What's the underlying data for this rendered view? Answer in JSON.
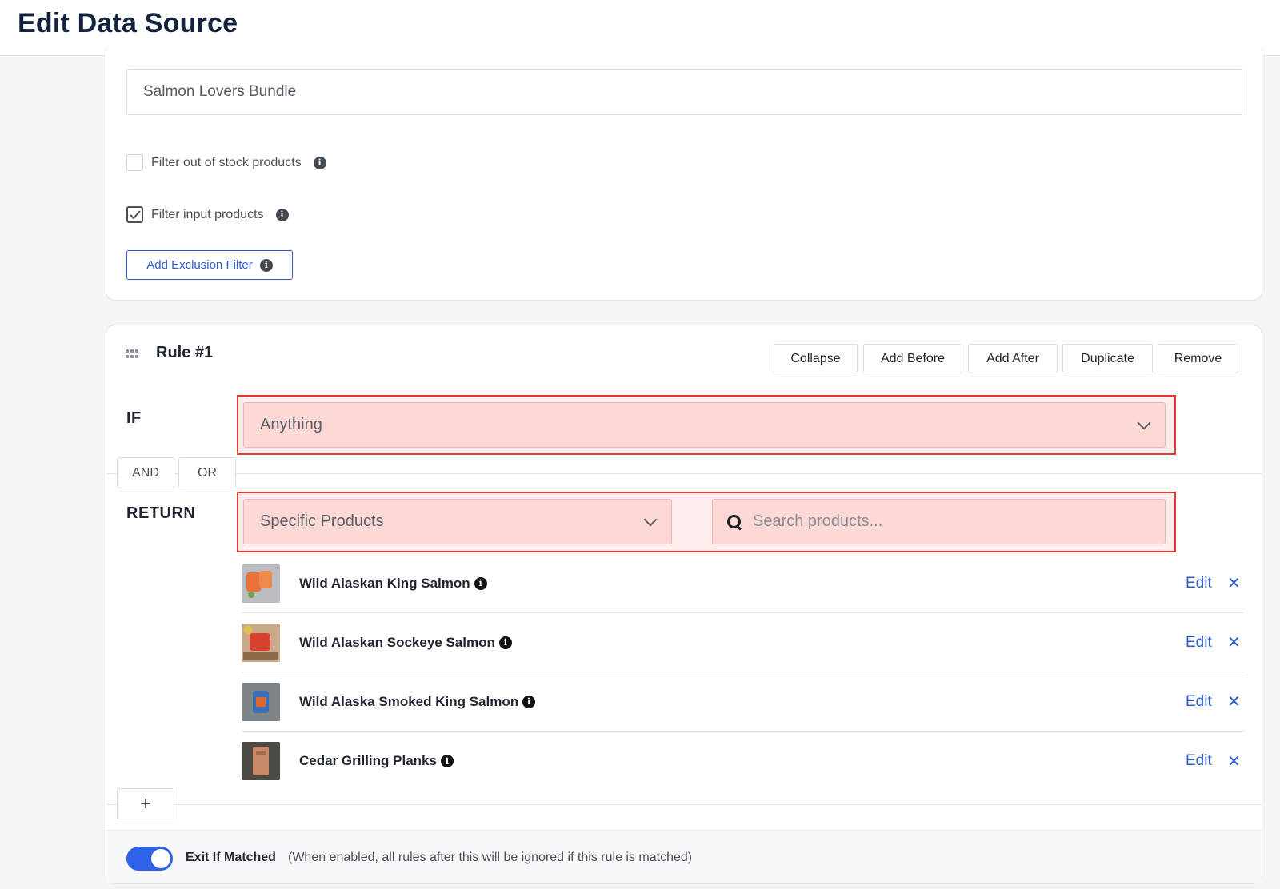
{
  "header": {
    "title": "Edit Data Source"
  },
  "source": {
    "name_value": "Salmon Lovers Bundle",
    "filter_out_of_stock": {
      "label": "Filter out of stock products",
      "checked": false
    },
    "filter_input": {
      "label": "Filter input products",
      "checked": true
    },
    "add_exclusion_label": "Add Exclusion Filter"
  },
  "rule": {
    "title": "Rule #1",
    "actions": [
      "Collapse",
      "Add Before",
      "Add After",
      "Duplicate",
      "Remove"
    ],
    "if_label": "IF",
    "if_value": "Anything",
    "and_label": "AND",
    "or_label": "OR",
    "return_label": "RETURN",
    "return_value": "Specific Products",
    "search_placeholder": "Search products...",
    "edit_label": "Edit",
    "remove_glyph": "✕",
    "products": [
      {
        "name": "Wild Alaskan King Salmon"
      },
      {
        "name": "Wild Alaskan Sockeye Salmon"
      },
      {
        "name": "Wild Alaska Smoked King Salmon"
      },
      {
        "name": "Cedar Grilling Planks"
      }
    ],
    "add_rule_glyph": "+"
  },
  "footer": {
    "exit_label": "Exit If Matched",
    "exit_note": "(When enabled, all rules after this will be ignored if this rule is matched)",
    "exit_enabled": true
  },
  "colors": {
    "accent": "#2f5bd3",
    "highlight_border": "#e53935",
    "highlight_fill": "#fdd9d6"
  }
}
